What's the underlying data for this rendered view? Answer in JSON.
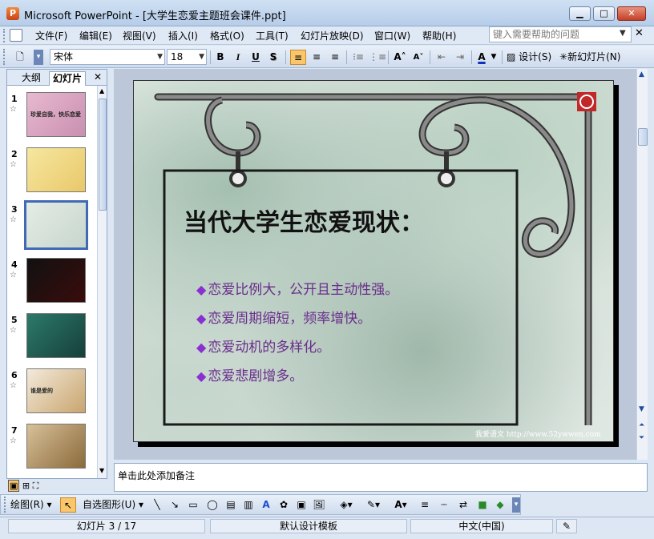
{
  "window": {
    "title": "Microsoft PowerPoint - [大学生恋爱主题班会课件.ppt]",
    "app_icon": "P",
    "minimize_label": "▁",
    "maximize_label": "□",
    "close_label": "✕"
  },
  "menu": {
    "items": [
      {
        "label": "文件(F)"
      },
      {
        "label": "编辑(E)"
      },
      {
        "label": "视图(V)"
      },
      {
        "label": "插入(I)"
      },
      {
        "label": "格式(O)"
      },
      {
        "label": "工具(T)"
      },
      {
        "label": "幻灯片放映(D)"
      },
      {
        "label": "窗口(W)"
      },
      {
        "label": "帮助(H)"
      }
    ],
    "help_placeholder": "键入需要帮助的问题",
    "doc_close": "✕"
  },
  "format_toolbar": {
    "font_name": "宋体",
    "font_size": "18",
    "bold": "B",
    "italic": "I",
    "underline": "U",
    "shadow": "S",
    "design_label": "设计(S)",
    "new_slide_label": "新幻灯片(N)"
  },
  "left_pane": {
    "tab_outline": "大纲",
    "tab_slides": "幻灯片",
    "close": "✕",
    "slides": [
      {
        "number": "1",
        "caption": "珍爱自我，快乐恋爱",
        "colors": [
          "#e8b9d0",
          "#c98fb0"
        ]
      },
      {
        "number": "2",
        "caption": "",
        "colors": [
          "#f6e7a0",
          "#e9c86a"
        ]
      },
      {
        "number": "3",
        "caption": "",
        "colors": [
          "#e4ece6",
          "#c7d6cc"
        ]
      },
      {
        "number": "4",
        "caption": "",
        "colors": [
          "#111111",
          "#3a0c0c"
        ]
      },
      {
        "number": "5",
        "caption": "",
        "colors": [
          "#2c7a6a",
          "#163f3a"
        ]
      },
      {
        "number": "6",
        "caption": "谁是爱的",
        "colors": [
          "#f3eadb",
          "#c9a56e"
        ]
      },
      {
        "number": "7",
        "caption": "",
        "colors": [
          "#d8c098",
          "#8a6a3a"
        ]
      }
    ]
  },
  "slide": {
    "title": "当代大学生恋爱现状：",
    "bullets": [
      "恋爱比例大，公开且主动性强。",
      "恋爱周期缩短，频率增快。",
      "恋爱动机的多样化。",
      "恋爱悲剧增多。"
    ],
    "bullet_symbol": "◆",
    "watermark": "我爱语文 http://www.52ywwen.com",
    "bullet_color": "#6a2d8c",
    "title_color": "#111111"
  },
  "notes": {
    "placeholder": "单击此处添加备注"
  },
  "draw_toolbar": {
    "draw_label": "绘图(R)",
    "autoshape_label": "自选图形(U)"
  },
  "status_bar": {
    "slide_info": "幻灯片 3 / 17",
    "template": "默认设计模板",
    "language": "中文(中国)"
  }
}
